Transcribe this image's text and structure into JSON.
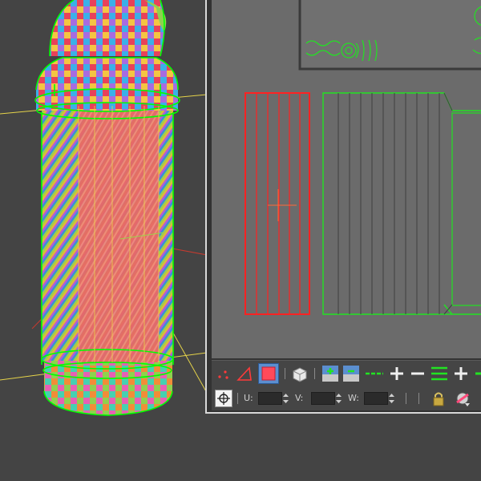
{
  "viewport": {
    "background": "#444444",
    "checker_colors": [
      "#e8415a",
      "#f4c542",
      "#3bb0e8",
      "#8fd14f",
      "#a86be0",
      "#f28c38",
      "#e85fb4",
      "#45d1b0"
    ],
    "wire_color": "#00ff00",
    "selected_color": "#e8413c",
    "axis_color": "#e6d44a"
  },
  "uv_editor": {
    "canvas_background": "#6b6b6b",
    "selected_island_color": "#ff2222",
    "island_color": "#22e322",
    "toolbar1": {
      "icons": [
        "vertex-select-icon",
        "edge-select-icon",
        "face-select-icon",
        "element-select-icon",
        "grow-icon",
        "shrink-icon",
        "loop-icon",
        "plus-icon",
        "minus-icon",
        "ring-icon",
        "plus-icon-2",
        "minus-icon-2"
      ]
    },
    "toolbar2": {
      "u_label": "U:",
      "v_label": "V:",
      "w_label": "W:",
      "u_value": "",
      "v_value": "",
      "w_value": ""
    }
  }
}
